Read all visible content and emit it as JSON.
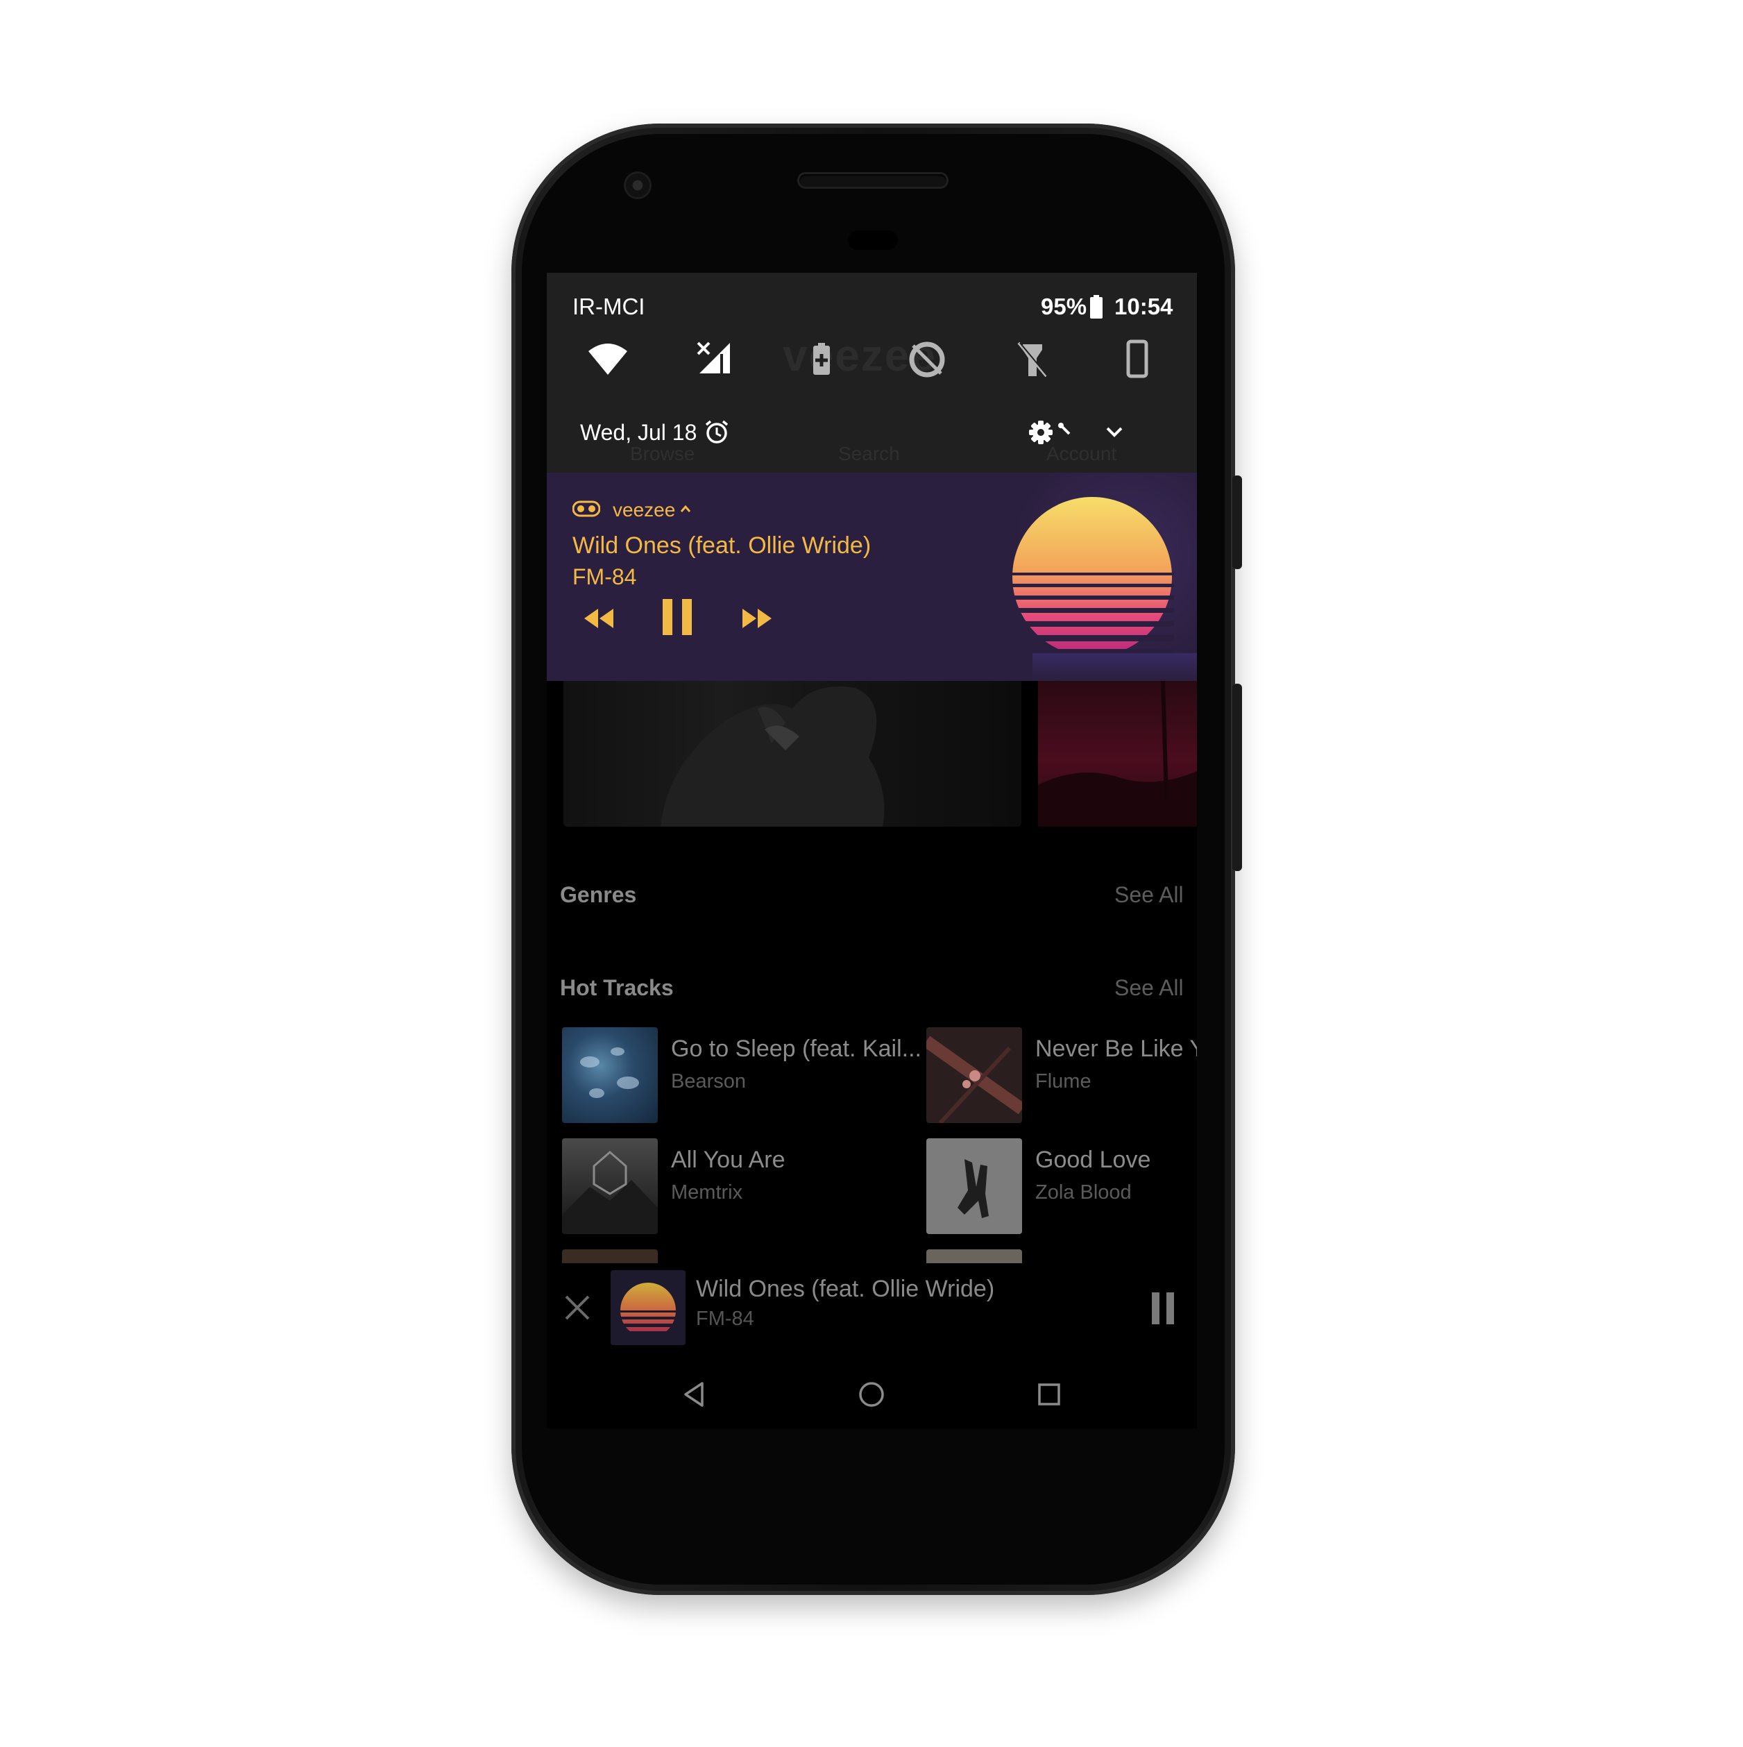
{
  "status_bar": {
    "carrier": "IR-MCI",
    "battery_percent": "95%",
    "time": "10:54"
  },
  "quick_settings": {
    "icons": [
      "wifi-icon",
      "mobile-data-off-icon",
      "battery-saver-icon",
      "data-saver-icon",
      "flashlight-off-icon",
      "auto-rotate-icon"
    ],
    "date": "Wed, Jul 18"
  },
  "background_app": {
    "app_name_ghost": "veezee",
    "tabs": [
      "Browse",
      "Search",
      "Account"
    ]
  },
  "media_notification": {
    "app_name": "veezee",
    "track_title": "Wild Ones (feat. Ollie Wride)",
    "artist": "FM-84",
    "accent_color": "#f3b945",
    "background_color": "#2b1f3f"
  },
  "sections": {
    "genres": {
      "title": "Genres",
      "see_all": "See All"
    },
    "hot_tracks": {
      "title": "Hot Tracks",
      "see_all": "See All"
    }
  },
  "hot_tracks": [
    {
      "title": "Go to Sleep (feat. Kail...",
      "artist": "Bearson"
    },
    {
      "title": "Never Be Like Y",
      "artist": "Flume"
    },
    {
      "title": "All You Are",
      "artist": "Memtrix"
    },
    {
      "title": "Good Love",
      "artist": "Zola Blood"
    }
  ],
  "mini_player": {
    "track_title": "Wild Ones (feat. Ollie Wride)",
    "artist": "FM-84"
  }
}
